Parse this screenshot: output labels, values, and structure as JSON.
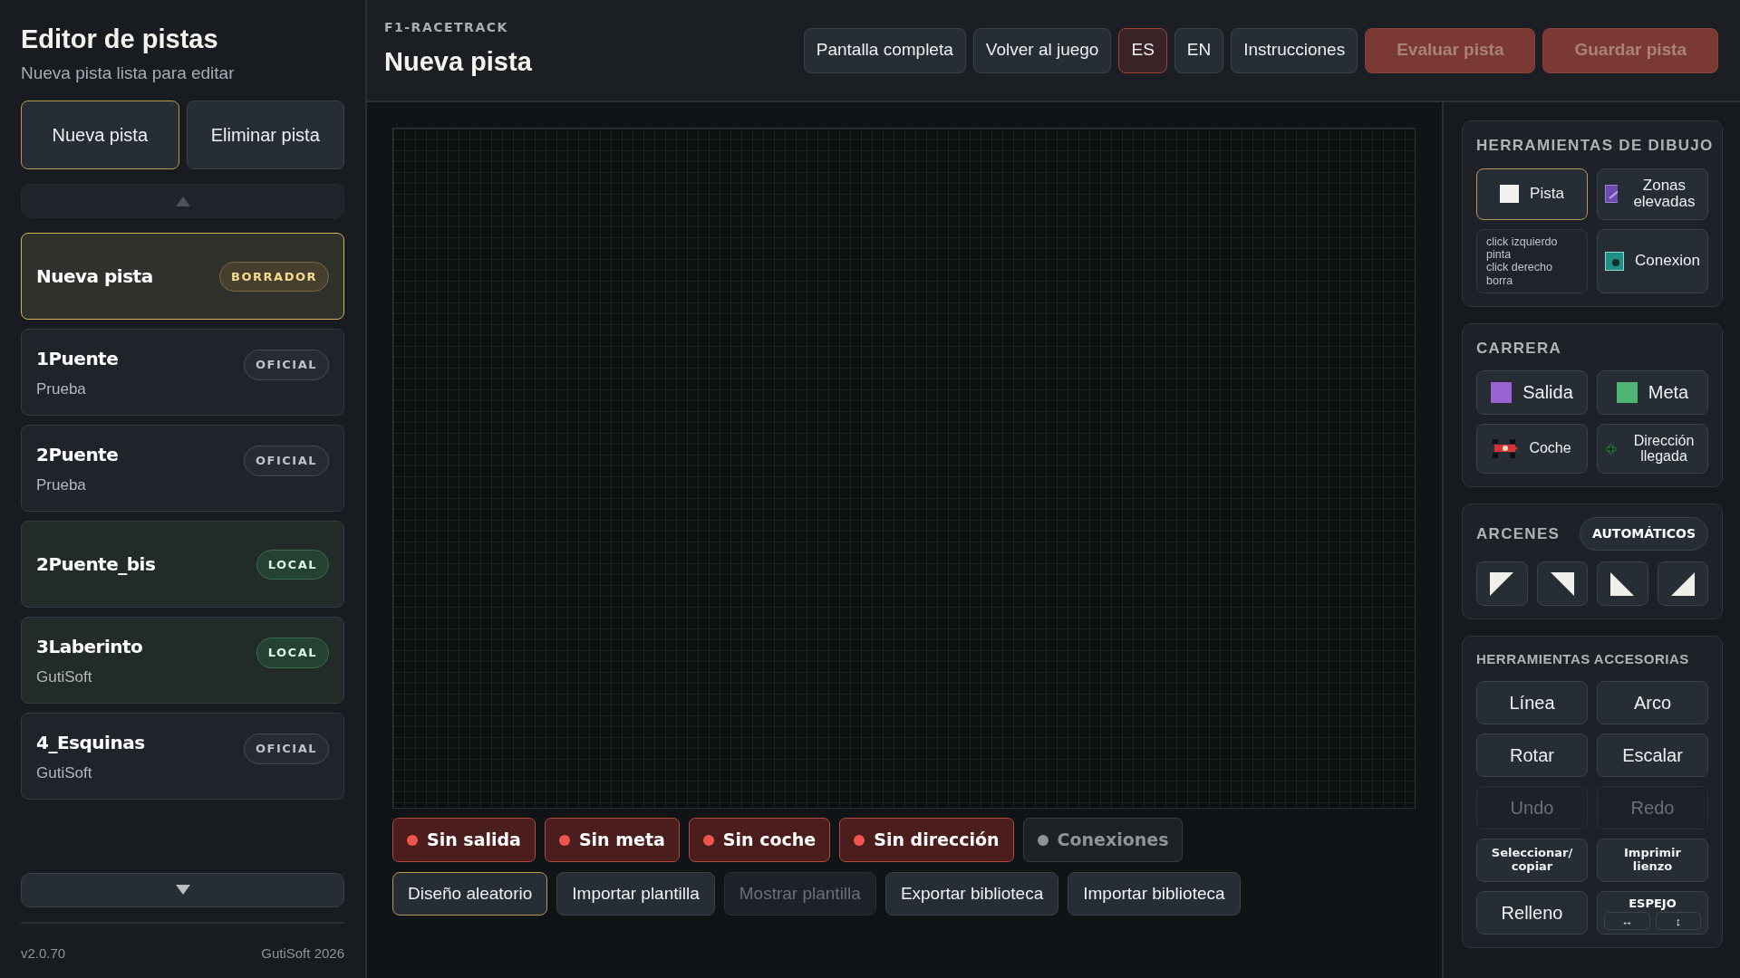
{
  "sidebar": {
    "title": "Editor de pistas",
    "subtitle": "Nueva pista lista para editar",
    "buttons": [
      {
        "label": "Nueva pista",
        "selected": true
      },
      {
        "label": "Eliminar pista",
        "selected": false
      }
    ],
    "tracks": [
      {
        "name": "Nueva pista",
        "badge": "BORRADOR",
        "kind": "draft",
        "selected": true
      },
      {
        "name": "1Puente",
        "author": "Prueba",
        "badge": "OFICIAL",
        "kind": "official",
        "selected": false
      },
      {
        "name": "2Puente",
        "author": "Prueba",
        "badge": "OFICIAL",
        "kind": "official",
        "selected": false
      },
      {
        "name": "2Puente_bis",
        "badge": "LOCAL",
        "kind": "local",
        "selected": false
      },
      {
        "name": "3Laberinto",
        "author": "GutiSoft",
        "badge": "LOCAL",
        "kind": "local",
        "selected": false
      },
      {
        "name": "4_Esquinas",
        "author": "GutiSoft",
        "badge": "OFICIAL",
        "kind": "official",
        "selected": false
      }
    ],
    "version": "v2.0.70",
    "copyright": "GutiSoft 2026"
  },
  "header": {
    "eyebrow": "F1-RACETRACK",
    "title": "Nueva pista",
    "nav_buttons": [
      "Pantalla completa",
      "Volver al juego"
    ],
    "languages": [
      {
        "label": "ES",
        "selected": true
      },
      {
        "label": "EN",
        "selected": false
      }
    ],
    "help_button": "Instrucciones",
    "actions": [
      {
        "label": "Evaluar pista",
        "disabled": true
      },
      {
        "label": "Guardar pista",
        "disabled": true
      }
    ]
  },
  "status_chips": [
    {
      "label": "Sin salida",
      "kind": "error"
    },
    {
      "label": "Sin meta",
      "kind": "error"
    },
    {
      "label": "Sin coche",
      "kind": "error"
    },
    {
      "label": "Sin dirección",
      "kind": "error"
    },
    {
      "label": "Conexiones",
      "kind": "neutral"
    }
  ],
  "canvas_actions": [
    {
      "label": "Diseño aleatorio",
      "selected": true,
      "disabled": false
    },
    {
      "label": "Importar plantilla",
      "selected": false,
      "disabled": false
    },
    {
      "label": "Mostrar plantilla",
      "selected": false,
      "disabled": true
    },
    {
      "label": "Exportar biblioteca",
      "selected": false,
      "disabled": false
    },
    {
      "label": "Importar biblioteca",
      "selected": false,
      "disabled": false
    }
  ],
  "drawing_tools": {
    "title": "HERRAMIENTAS DE DIBUJO",
    "items": [
      {
        "kind": "track",
        "label": "Pista",
        "selected": true
      },
      {
        "kind": "elevated",
        "label": "Zonas elevadas",
        "selected": false
      },
      {
        "kind": "hint",
        "label": "click izquierdo pinta\nclick derecho borra"
      },
      {
        "kind": "connection",
        "label": "Conexion",
        "selected": false
      }
    ]
  },
  "race": {
    "title": "CARRERA",
    "items": [
      {
        "kind": "start",
        "label": "Salida"
      },
      {
        "kind": "finish",
        "label": "Meta"
      },
      {
        "kind": "car",
        "label": "Coche"
      },
      {
        "kind": "direction",
        "label": "Dirección llegada"
      }
    ]
  },
  "shoulders": {
    "title": "ARCENES",
    "toggle": "AUTOMÁTICOS",
    "corners": [
      {
        "kind": "top-left"
      },
      {
        "kind": "top-right"
      },
      {
        "kind": "bottom-left"
      },
      {
        "kind": "bottom-right"
      }
    ]
  },
  "accessories": {
    "title": "HERRAMIENTAS ACCESORIAS",
    "items": [
      {
        "kind": "button",
        "label": "Línea",
        "disabled": false
      },
      {
        "kind": "button",
        "label": "Arco",
        "disabled": false
      },
      {
        "kind": "button",
        "label": "Rotar",
        "disabled": false
      },
      {
        "kind": "button",
        "label": "Escalar",
        "disabled": false
      },
      {
        "kind": "button",
        "label": "Undo",
        "disabled": true
      },
      {
        "kind": "button",
        "label": "Redo",
        "disabled": true
      },
      {
        "kind": "compact",
        "label": "Seleccionar/ copiar",
        "disabled": false
      },
      {
        "kind": "compact",
        "label": "Imprimir lienzo",
        "disabled": false
      },
      {
        "kind": "button",
        "label": "Relleno",
        "disabled": false
      },
      {
        "kind": "mirror",
        "label": "ESPEJO",
        "options": [
          "↔",
          "↕"
        ],
        "disabled": false
      }
    ]
  }
}
